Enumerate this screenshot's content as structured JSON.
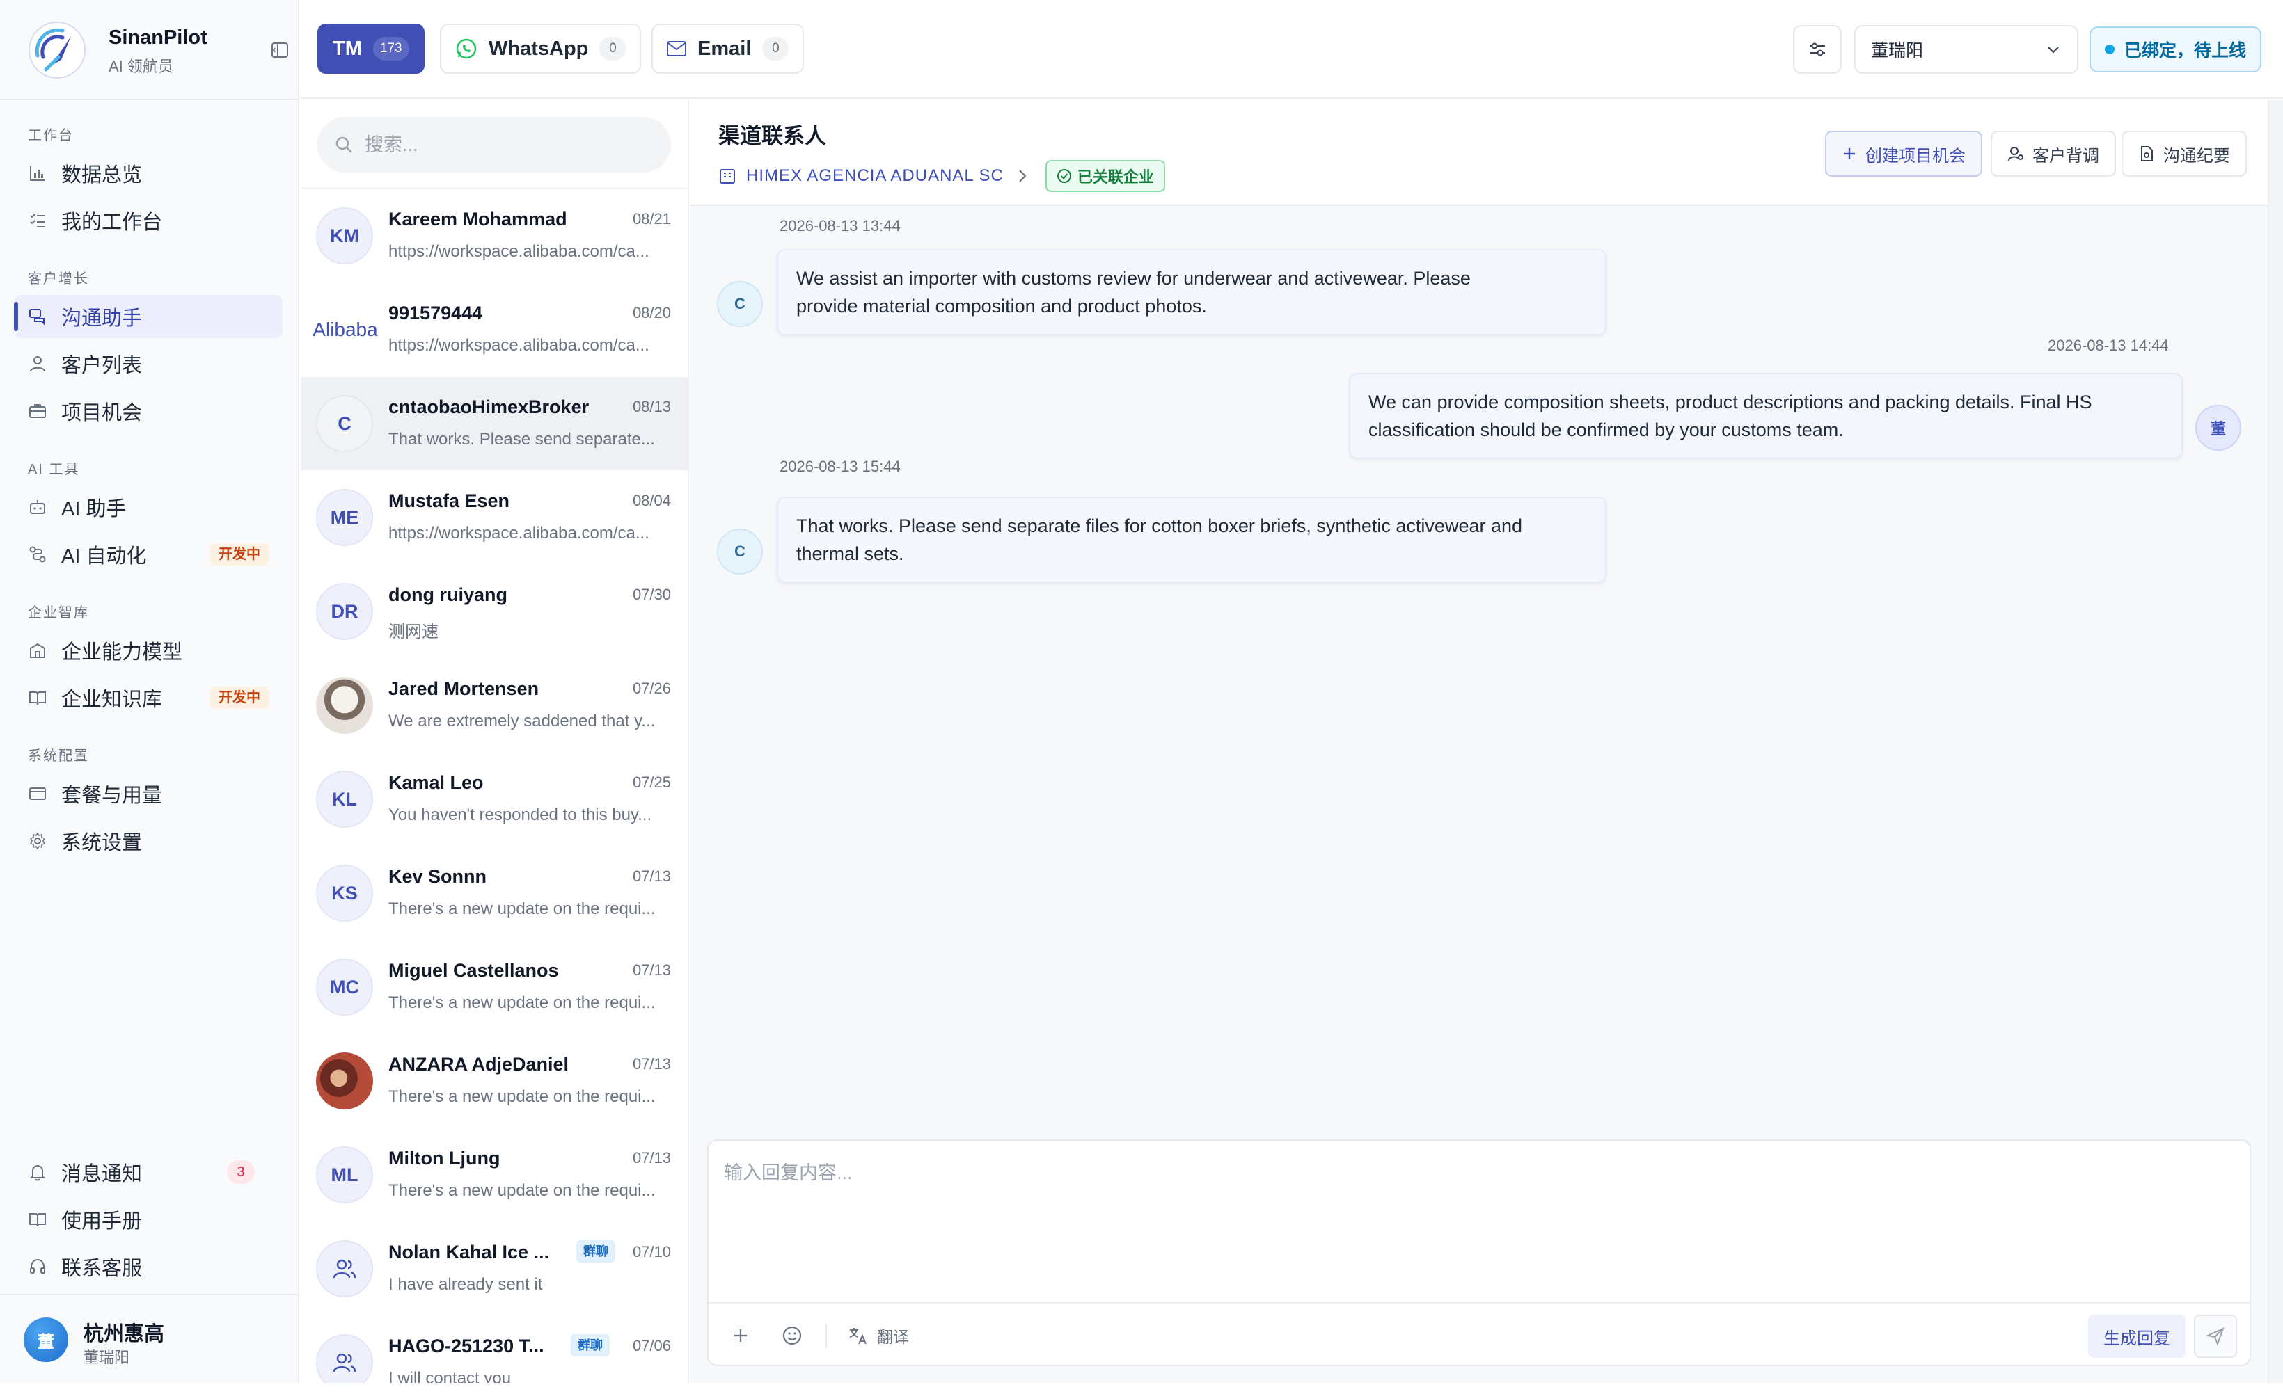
{
  "brand": {
    "name": "SinanPilot",
    "subtitle": "AI 领航员"
  },
  "nav": {
    "sections": {
      "workbench": "工作台",
      "growth": "客户增长",
      "ai_tools": "AI 工具",
      "knowledge": "企业智库",
      "system": "系统配置"
    },
    "items": [
      {
        "label": "数据总览"
      },
      {
        "label": "我的工作台"
      },
      {
        "label": "沟通助手"
      },
      {
        "label": "客户列表"
      },
      {
        "label": "项目机会"
      },
      {
        "label": "AI 助手"
      },
      {
        "label": "AI 自动化",
        "badge": "开发中"
      },
      {
        "label": "企业能力模型"
      },
      {
        "label": "企业知识库",
        "badge": "开发中"
      },
      {
        "label": "套餐与用量"
      },
      {
        "label": "系统设置"
      }
    ],
    "bottom": [
      {
        "label": "消息通知",
        "count": "3"
      },
      {
        "label": "使用手册"
      },
      {
        "label": "联系客服"
      }
    ]
  },
  "user": {
    "avatar": "董",
    "name": "杭州惠高",
    "sub": "董瑞阳"
  },
  "channels": [
    {
      "label": "TM",
      "count": "173"
    },
    {
      "label": "WhatsApp",
      "count": "0"
    },
    {
      "label": "Email",
      "count": "0"
    }
  ],
  "topbar": {
    "selected_user": "董瑞阳",
    "status": "已绑定，待上线"
  },
  "search": {
    "placeholder": "搜索..."
  },
  "conversations": [
    {
      "avatar": "KM",
      "name": "Kareem Mohammad",
      "date": "08/21",
      "preview": "https://workspace.alibaba.com/ca..."
    },
    {
      "avatar": "Alibaba",
      "name": "991579444",
      "date": "08/20",
      "preview": "https://workspace.alibaba.com/ca..."
    },
    {
      "avatar": "C",
      "name": "cntaobaoHimexBroker",
      "date": "08/13",
      "preview": "That works. Please send separate..."
    },
    {
      "avatar": "ME",
      "name": "Mustafa Esen",
      "date": "08/04",
      "preview": "https://workspace.alibaba.com/ca..."
    },
    {
      "avatar": "DR",
      "name": "dong ruiyang",
      "date": "07/30",
      "preview": "测网速"
    },
    {
      "avatar": "",
      "name": "Jared Mortensen",
      "date": "07/26",
      "preview": "We are extremely saddened that y..."
    },
    {
      "avatar": "KL",
      "name": "Kamal Leo",
      "date": "07/25",
      "preview": "You haven't responded to this buy..."
    },
    {
      "avatar": "KS",
      "name": "Kev Sonnn",
      "date": "07/13",
      "preview": "There's a new update on the requi..."
    },
    {
      "avatar": "MC",
      "name": "Miguel Castellanos",
      "date": "07/13",
      "preview": "There's a new update on the requi..."
    },
    {
      "avatar": "",
      "name": "ANZARA AdjeDaniel",
      "date": "07/13",
      "preview": "There's a new update on the requi..."
    },
    {
      "avatar": "ML",
      "name": "Milton Ljung",
      "date": "07/13",
      "preview": "There's a new update on the requi..."
    },
    {
      "avatar": "",
      "name": "Nolan Kahal Ice ...",
      "date": "07/10",
      "preview": "I have already sent it",
      "badge": "群聊"
    },
    {
      "avatar": "",
      "name": "HAGO-251230 T...",
      "date": "07/06",
      "preview": "I will contact you",
      "badge": "群聊"
    }
  ],
  "chat": {
    "title": "渠道联系人",
    "company": "HIMEX AGENCIA ADUANAL SC",
    "linked": "已关联企业",
    "actions": {
      "create": "创建项目机会",
      "profile": "客户背调",
      "summary": "沟通纪要"
    },
    "messages": [
      {
        "time": "2026-08-13 13:44",
        "avatar": "C",
        "text_lines": [
          "We assist an importer with customs review for underwear and activewear. Please",
          "provide material composition and product photos."
        ]
      },
      {
        "time": "2026-08-13 14:44",
        "avatar": "董",
        "text_lines": [
          "We can provide composition sheets, product descriptions and packing details. Final HS",
          "classification should be confirmed by your customs team."
        ]
      },
      {
        "time": "2026-08-13 15:44",
        "avatar": "C",
        "text_lines": [
          "That works. Please send separate files for cotton boxer briefs, synthetic activewear and",
          "thermal sets."
        ]
      }
    ],
    "composer": {
      "placeholder": "输入回复内容...",
      "translate": "翻译",
      "generate": "生成回复"
    }
  },
  "colors": {
    "accent": "#3f4fb4",
    "status_blue": "#0ea5e9",
    "linked_green": "#15803d",
    "badge_orange": "#c2410c"
  }
}
